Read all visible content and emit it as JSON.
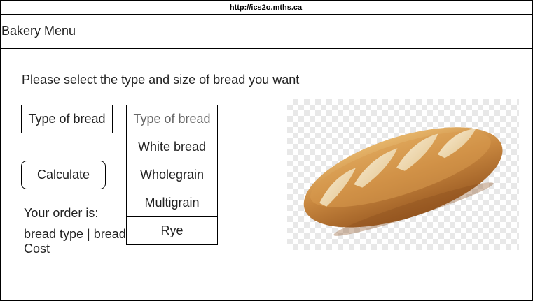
{
  "browser": {
    "url": "http://ics2o.mths.ca"
  },
  "header": {
    "title": "Bakery Menu"
  },
  "main": {
    "prompt": "Please select the type and size of bread you want",
    "type_label": "Type of bread",
    "calculate_label": "Calculate",
    "dropdown": {
      "placeholder": "Type of bread",
      "options": [
        "White bread",
        "Wholegrain",
        "Multigrain",
        "Rye"
      ]
    },
    "order": {
      "label": "Your order is:",
      "detail": "bread type | bread",
      "cost": "Cost"
    }
  },
  "colors": {
    "border": "#000000",
    "text": "#222222",
    "bread_crust": "#c8873f"
  },
  "icons": {
    "bread_image": "baguette-image"
  }
}
